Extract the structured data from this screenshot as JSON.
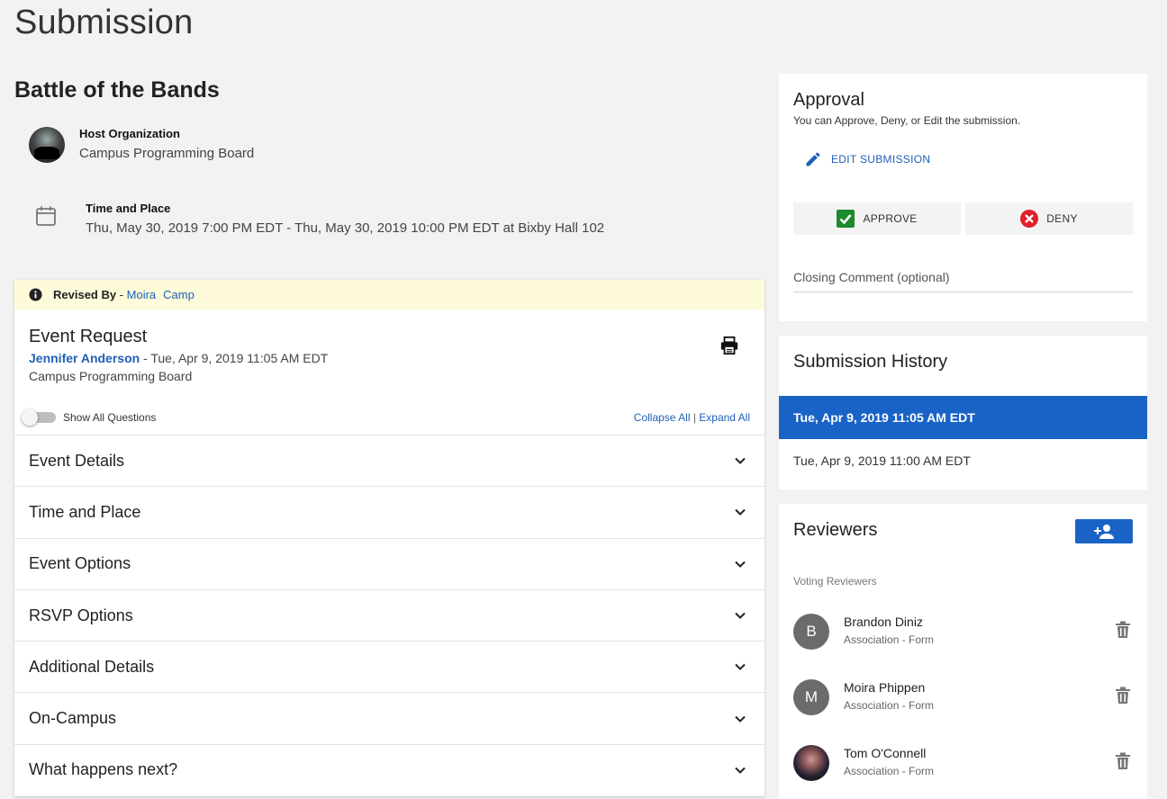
{
  "page": {
    "title": "Submission"
  },
  "event": {
    "name": "Battle of the Bands",
    "host_label": "Host Organization",
    "host_value": "Campus Programming Board",
    "time_label": "Time and Place",
    "time_value": "Thu, May 30, 2019 7:00 PM EDT - Thu, May 30, 2019 10:00 PM EDT at Bixby Hall 102"
  },
  "form": {
    "revised_label": "Revised By",
    "revised_sep": " - ",
    "revised_first": "Moira",
    "revised_last": "Camp",
    "title": "Event Request",
    "author": "Jennifer Anderson",
    "author_suffix": " - Tue, Apr 9, 2019 11:05 AM EDT",
    "org": "Campus Programming Board",
    "toggle_label": "Show All Questions",
    "collapse_all": "Collapse All",
    "link_sep": " | ",
    "expand_all": "Expand All",
    "sections": [
      "Event Details",
      "Time and Place",
      "Event Options",
      "RSVP Options",
      "Additional Details",
      "On-Campus",
      "What happens next?"
    ]
  },
  "approval": {
    "title": "Approval",
    "subtitle": "You can Approve, Deny, or Edit the submission.",
    "edit_label": "EDIT SUBMISSION",
    "approve_label": "APPROVE",
    "deny_label": "DENY",
    "closing_placeholder": "Closing Comment (optional)"
  },
  "history": {
    "title": "Submission History",
    "items": [
      "Tue, Apr 9, 2019 11:05 AM EDT",
      "Tue, Apr 9, 2019 11:00 AM EDT"
    ]
  },
  "reviewers": {
    "title": "Reviewers",
    "voting_label": "Voting Reviewers",
    "list": [
      {
        "initial": "B",
        "name": "Brandon Diniz",
        "role": "Association - Form"
      },
      {
        "initial": "M",
        "name": "Moira Phippen",
        "role": "Association - Form"
      },
      {
        "initial": "",
        "name": "Tom O'Connell",
        "role": "Association - Form"
      }
    ]
  },
  "colors": {
    "accent": "#1a63c6",
    "link": "#2160b8",
    "approve": "#1e8a2e",
    "deny": "#e0202a",
    "revised_bg": "#fdfbd9"
  }
}
